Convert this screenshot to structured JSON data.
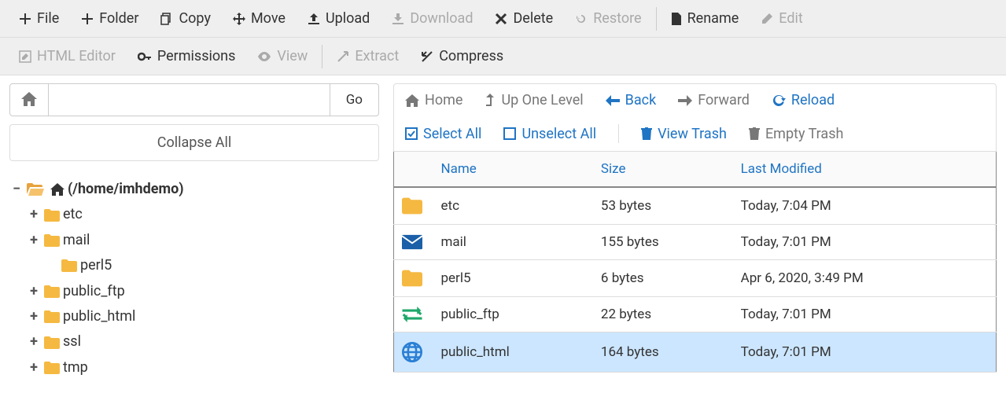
{
  "toolbar": {
    "file": "File",
    "folder": "Folder",
    "copy": "Copy",
    "move": "Move",
    "upload": "Upload",
    "download": "Download",
    "delete": "Delete",
    "restore": "Restore",
    "rename": "Rename",
    "edit": "Edit",
    "html_editor": "HTML Editor",
    "permissions": "Permissions",
    "view": "View",
    "extract": "Extract",
    "compress": "Compress"
  },
  "pathbar": {
    "go": "Go",
    "value": ""
  },
  "collapse_all": "Collapse All",
  "tree": {
    "root": "(/home/imhdemo)",
    "items": [
      {
        "name": "etc",
        "toggle": "+"
      },
      {
        "name": "mail",
        "toggle": "+"
      },
      {
        "name": "perl5",
        "toggle": ""
      },
      {
        "name": "public_ftp",
        "toggle": "+"
      },
      {
        "name": "public_html",
        "toggle": "+"
      },
      {
        "name": "ssl",
        "toggle": "+"
      },
      {
        "name": "tmp",
        "toggle": "+"
      }
    ]
  },
  "nav": {
    "home": "Home",
    "up": "Up One Level",
    "back": "Back",
    "forward": "Forward",
    "reload": "Reload",
    "select_all": "Select All",
    "unselect_all": "Unselect All",
    "view_trash": "View Trash",
    "empty_trash": "Empty Trash"
  },
  "columns": {
    "name": "Name",
    "size": "Size",
    "modified": "Last Modified"
  },
  "files": [
    {
      "icon": "folder",
      "name": "etc",
      "size": "53 bytes",
      "modified": "Today, 7:04 PM",
      "selected": false
    },
    {
      "icon": "mail",
      "name": "mail",
      "size": "155 bytes",
      "modified": "Today, 7:01 PM",
      "selected": false
    },
    {
      "icon": "folder",
      "name": "perl5",
      "size": "6 bytes",
      "modified": "Apr 6, 2020, 3:49 PM",
      "selected": false
    },
    {
      "icon": "ftp",
      "name": "public_ftp",
      "size": "22 bytes",
      "modified": "Today, 7:01 PM",
      "selected": false
    },
    {
      "icon": "globe",
      "name": "public_html",
      "size": "164 bytes",
      "modified": "Today, 7:01 PM",
      "selected": true
    }
  ]
}
